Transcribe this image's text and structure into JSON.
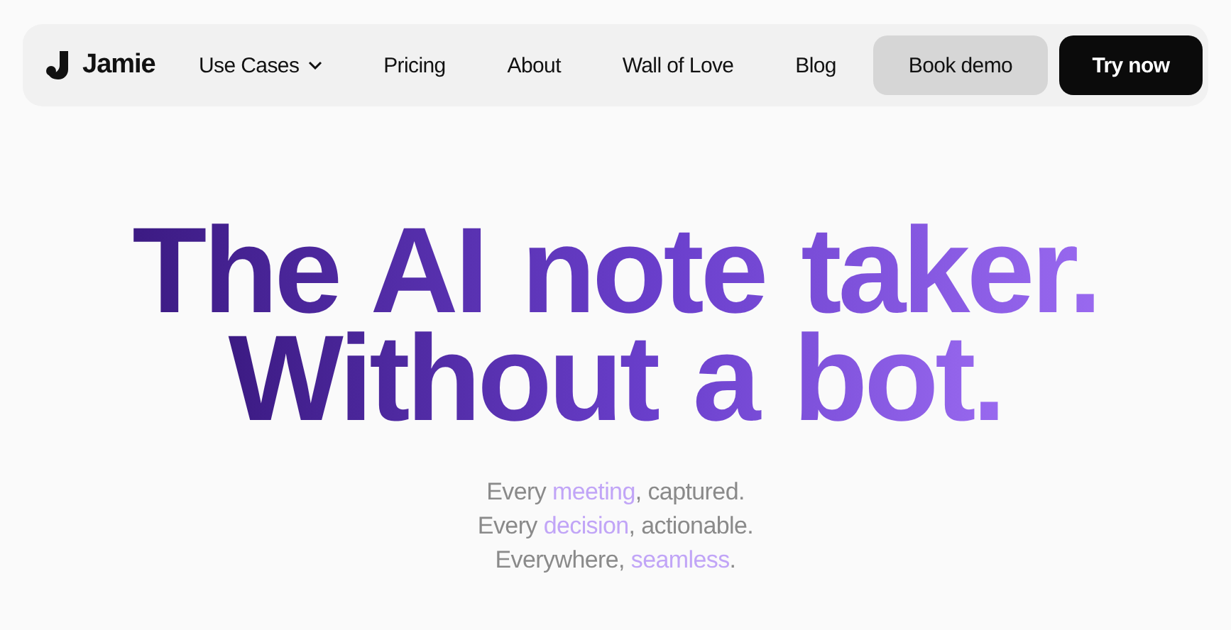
{
  "nav": {
    "brand": "Jamie",
    "links": [
      {
        "label": "Use Cases",
        "dropdown": true
      },
      {
        "label": "Pricing",
        "dropdown": false
      },
      {
        "label": "About",
        "dropdown": false
      },
      {
        "label": "Wall of Love",
        "dropdown": false
      },
      {
        "label": "Blog",
        "dropdown": false
      }
    ],
    "buttons": [
      {
        "label": "Book demo",
        "kind": "secondary"
      },
      {
        "label": "Try now",
        "kind": "primary"
      }
    ]
  },
  "hero": {
    "headline": [
      "The AI note taker.",
      "Without a bot."
    ],
    "tagline": [
      {
        "before": "Every ",
        "highlight": "meeting",
        "after": ", captured."
      },
      {
        "before": "Every ",
        "highlight": "decision",
        "after": ", actionable."
      },
      {
        "before": "Everywhere, ",
        "highlight": "seamless",
        "after": "."
      }
    ]
  }
}
